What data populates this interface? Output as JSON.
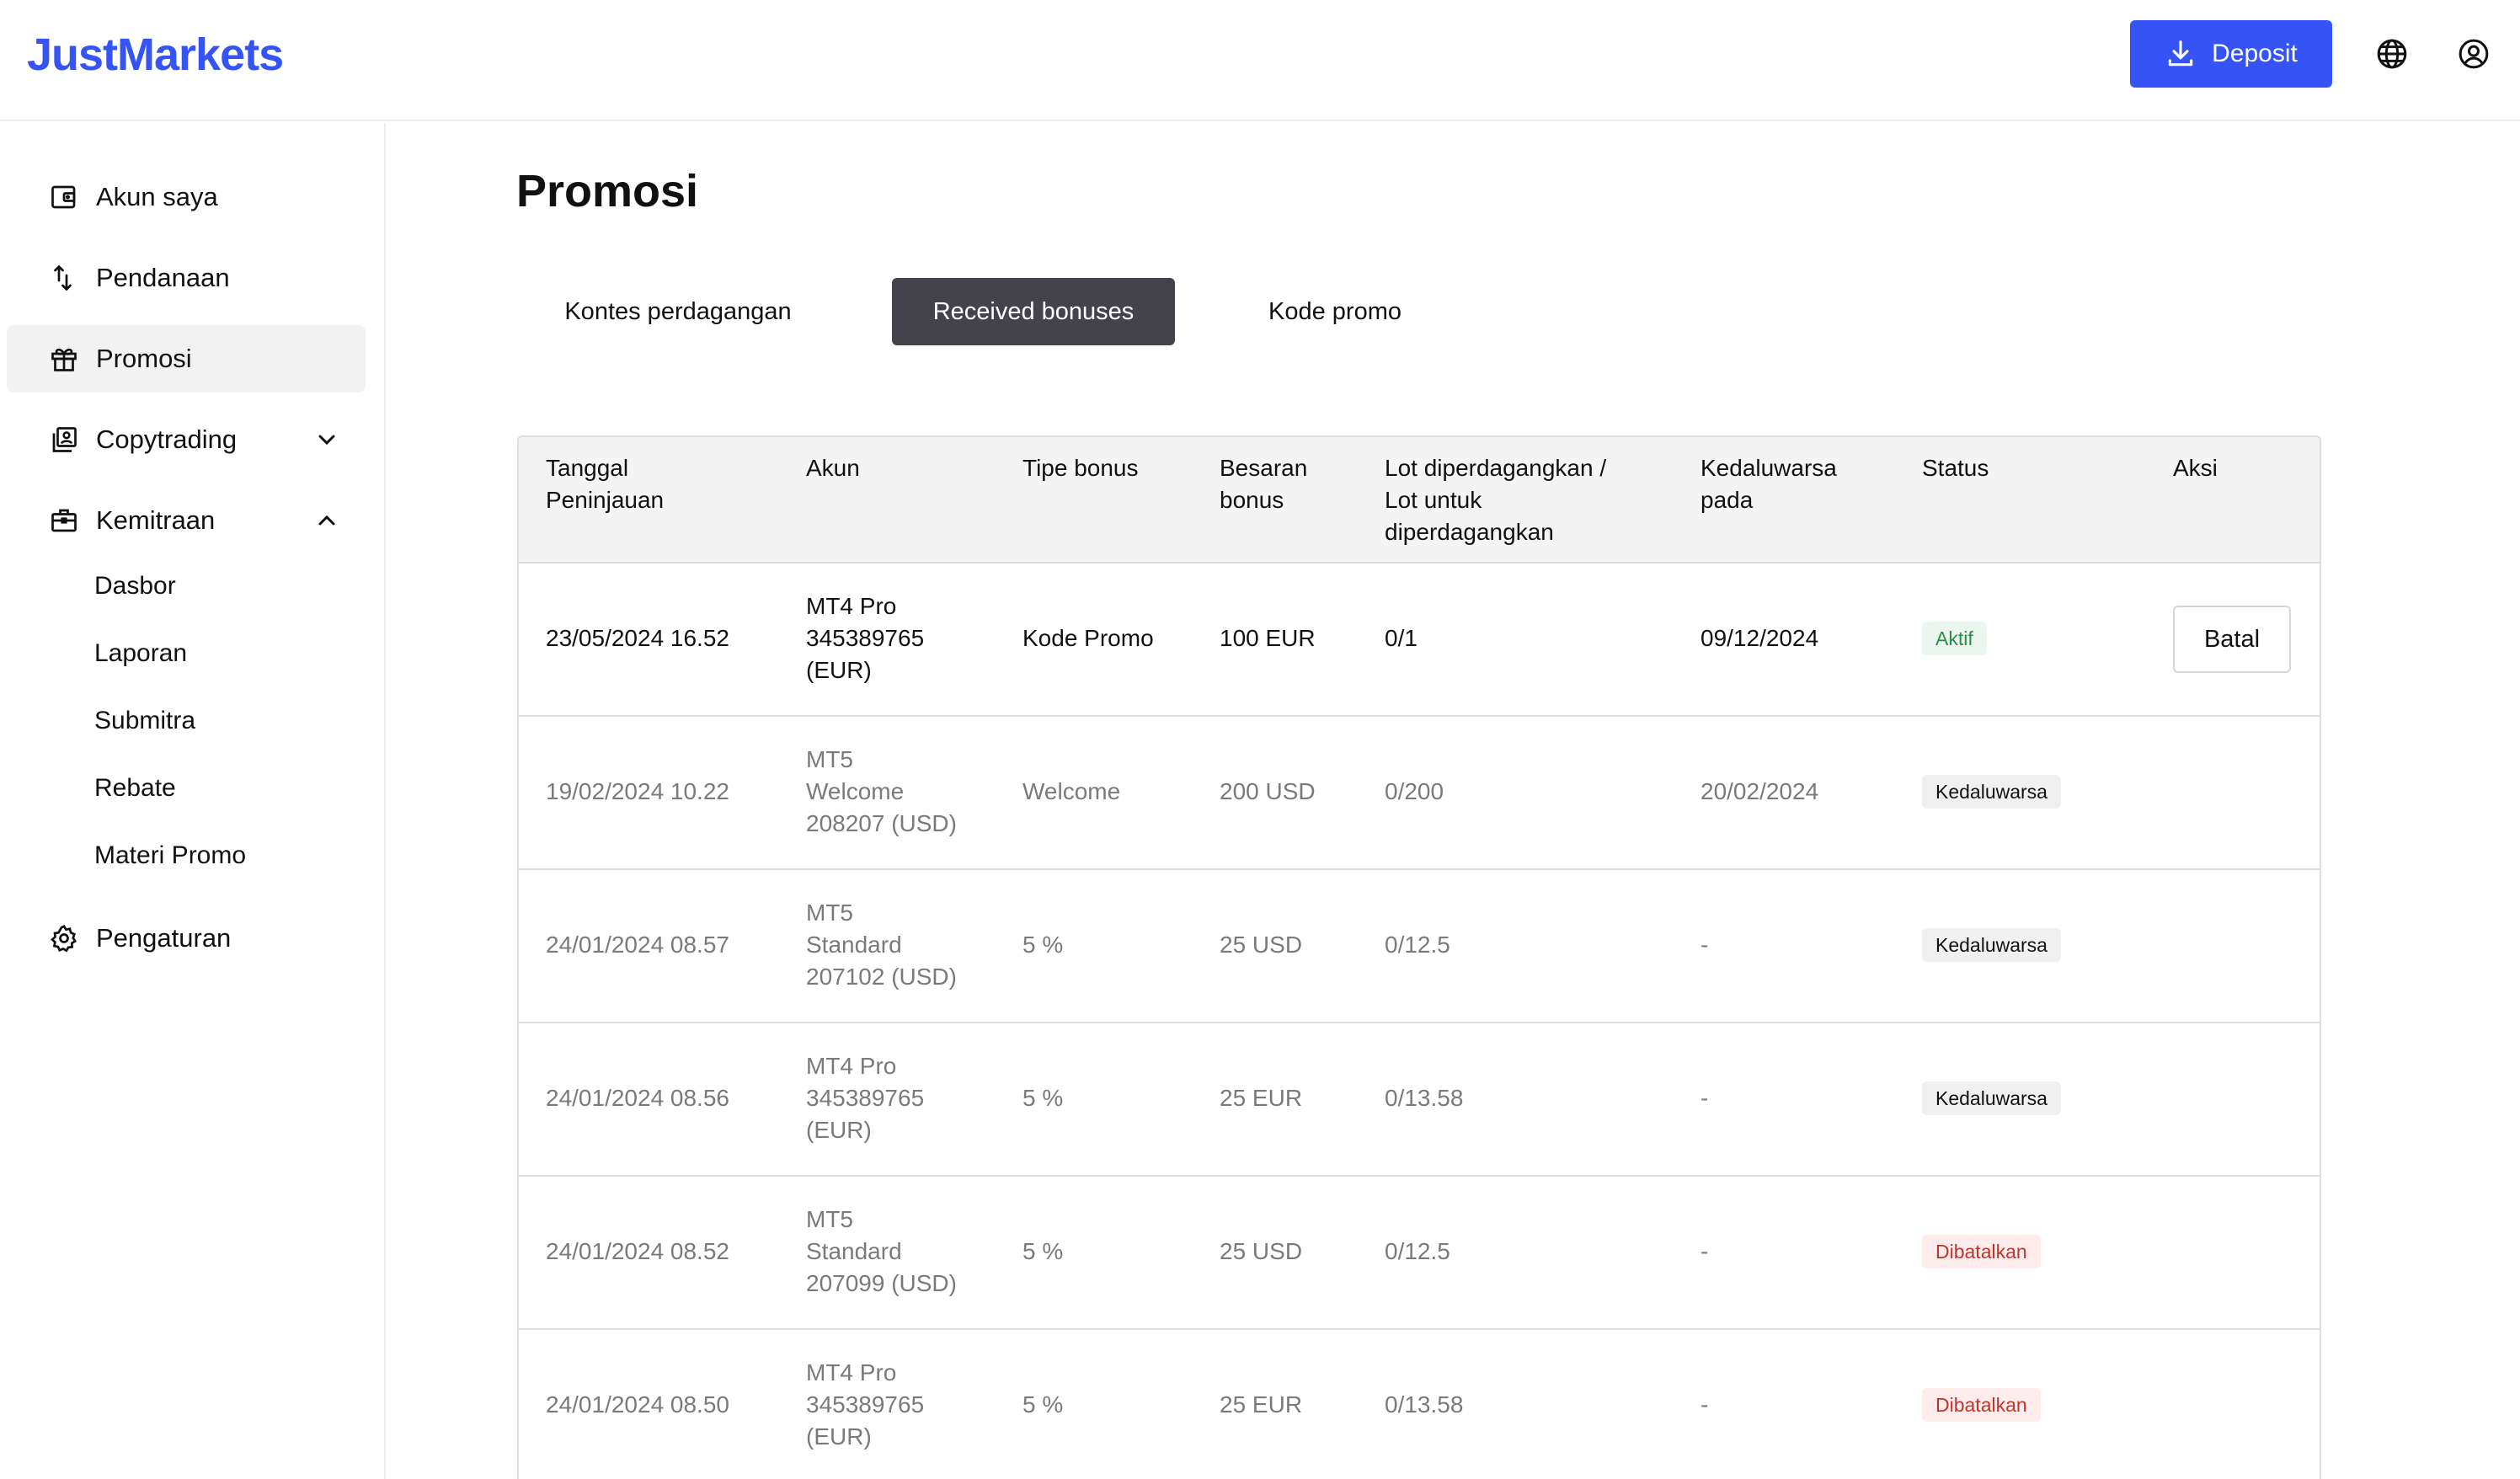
{
  "header": {
    "logo": "JustMarkets",
    "deposit_label": "Deposit",
    "icons": [
      "download-icon",
      "globe-icon",
      "user-circle-icon"
    ]
  },
  "sidebar": {
    "items": [
      {
        "label": "Akun saya",
        "icon": "wallet-icon"
      },
      {
        "label": "Pendanaan",
        "icon": "transfer-arrows-icon"
      },
      {
        "label": "Promosi",
        "icon": "gift-icon",
        "active": true
      },
      {
        "label": "Copytrading",
        "icon": "copy-portrait-icon",
        "chevron": "down"
      },
      {
        "label": "Kemitraan",
        "icon": "briefcase-icon",
        "chevron": "up"
      }
    ],
    "sub_items": [
      "Dasbor",
      "Laporan",
      "Submitra",
      "Rebate",
      "Materi Promo"
    ],
    "settings": {
      "label": "Pengaturan",
      "icon": "gear-icon"
    }
  },
  "main": {
    "title": "Promosi",
    "tabs": [
      {
        "label": "Kontes perdagangan",
        "active": false
      },
      {
        "label": "Received bonuses",
        "active": true
      },
      {
        "label": "Kode promo",
        "active": false
      }
    ],
    "table": {
      "headers": {
        "date": [
          "Tanggal",
          "Peninjauan"
        ],
        "account": [
          "Akun"
        ],
        "type": [
          "Tipe bonus"
        ],
        "amount": [
          "Besaran",
          "bonus"
        ],
        "lots": [
          "Lot diperdagangkan /",
          "Lot untuk",
          "diperdagangkan"
        ],
        "expires": [
          "Kedaluwarsa",
          "pada"
        ],
        "status": [
          "Status"
        ],
        "action": [
          "Aksi"
        ]
      },
      "rows": [
        {
          "date": "23/05/2024 16.52",
          "account": [
            "MT4 Pro",
            "345389765",
            "(EUR)"
          ],
          "type": "Kode Promo",
          "amount": "100 EUR",
          "lots": "0/1",
          "expires": "09/12/2024",
          "status": "Aktif",
          "status_color": "green",
          "action": "Batal"
        },
        {
          "date": "19/02/2024 10.22",
          "account": [
            "MT5",
            "Welcome",
            "208207 (USD)"
          ],
          "type": "Welcome",
          "amount": "200 USD",
          "lots": "0/200",
          "expires": "20/02/2024",
          "status": "Kedaluwarsa",
          "status_color": "gray",
          "action": ""
        },
        {
          "date": "24/01/2024 08.57",
          "account": [
            "MT5",
            "Standard",
            "207102 (USD)"
          ],
          "type": "5 %",
          "amount": "25 USD",
          "lots": "0/12.5",
          "expires": "-",
          "status": "Kedaluwarsa",
          "status_color": "gray",
          "action": ""
        },
        {
          "date": "24/01/2024 08.56",
          "account": [
            "MT4 Pro",
            "345389765",
            "(EUR)"
          ],
          "type": "5 %",
          "amount": "25 EUR",
          "lots": "0/13.58",
          "expires": "-",
          "status": "Kedaluwarsa",
          "status_color": "gray",
          "action": ""
        },
        {
          "date": "24/01/2024 08.52",
          "account": [
            "MT5",
            "Standard",
            "207099 (USD)"
          ],
          "type": "5 %",
          "amount": "25 USD",
          "lots": "0/12.5",
          "expires": "-",
          "status": "Dibatalkan",
          "status_color": "red",
          "action": ""
        },
        {
          "date": "24/01/2024 08.50",
          "account": [
            "MT4 Pro",
            "345389765",
            "(EUR)"
          ],
          "type": "5 %",
          "amount": "25 EUR",
          "lots": "0/13.58",
          "expires": "-",
          "status": "Dibatalkan",
          "status_color": "red",
          "action": ""
        }
      ]
    }
  },
  "colors": {
    "brand": "#3654f5",
    "tab_active_bg": "#44434b",
    "status_green": "#2e8b4a",
    "status_red": "#c0342b"
  }
}
